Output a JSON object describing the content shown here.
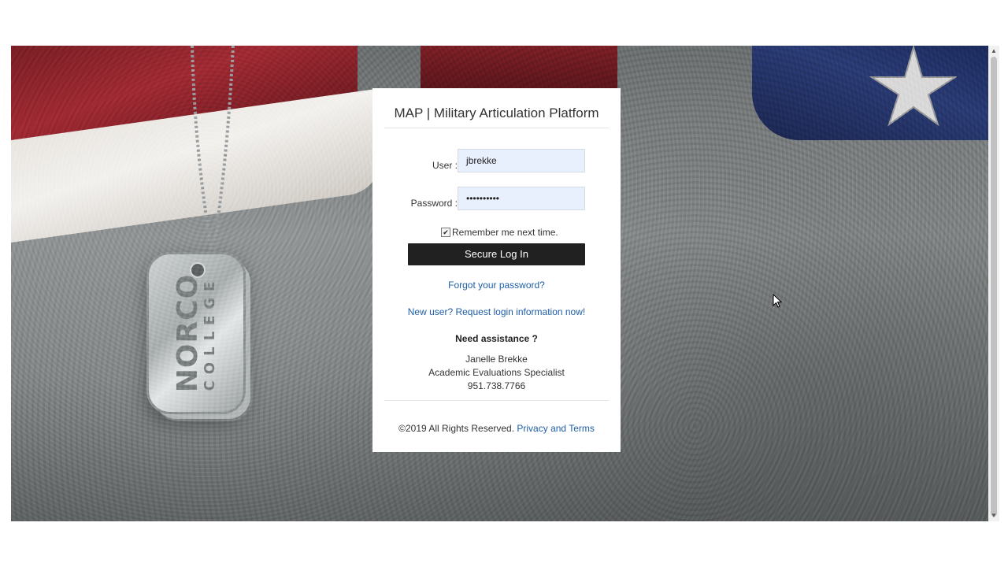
{
  "login": {
    "title": "MAP | Military Articulation Platform",
    "user_label": "User :",
    "user_value": "jbrekke",
    "password_label": "Password :",
    "password_value": "••••••••••",
    "remember_checked": true,
    "remember_label": "Remember me next time.",
    "submit_label": "Secure Log In",
    "forgot_link": "Forgot your password?",
    "new_user_link": "New user? Request login information now!"
  },
  "assistance": {
    "title": "Need assistance ?",
    "name": "Janelle Brekke",
    "role": "Academic Evaluations Specialist",
    "phone": "951.738.7766"
  },
  "footer": {
    "copyright": "©2019 All Rights Reserved.",
    "privacy_link": "Privacy and Terms"
  },
  "background": {
    "dogtag_line1": "NORCO",
    "dogtag_line2": "COLLEGE"
  },
  "colors": {
    "link": "#1e5ea8",
    "button": "#212121",
    "autofill": "#e8f0fe"
  },
  "icons": {
    "checkbox": "checkmark",
    "cursor": "mouse-pointer"
  }
}
